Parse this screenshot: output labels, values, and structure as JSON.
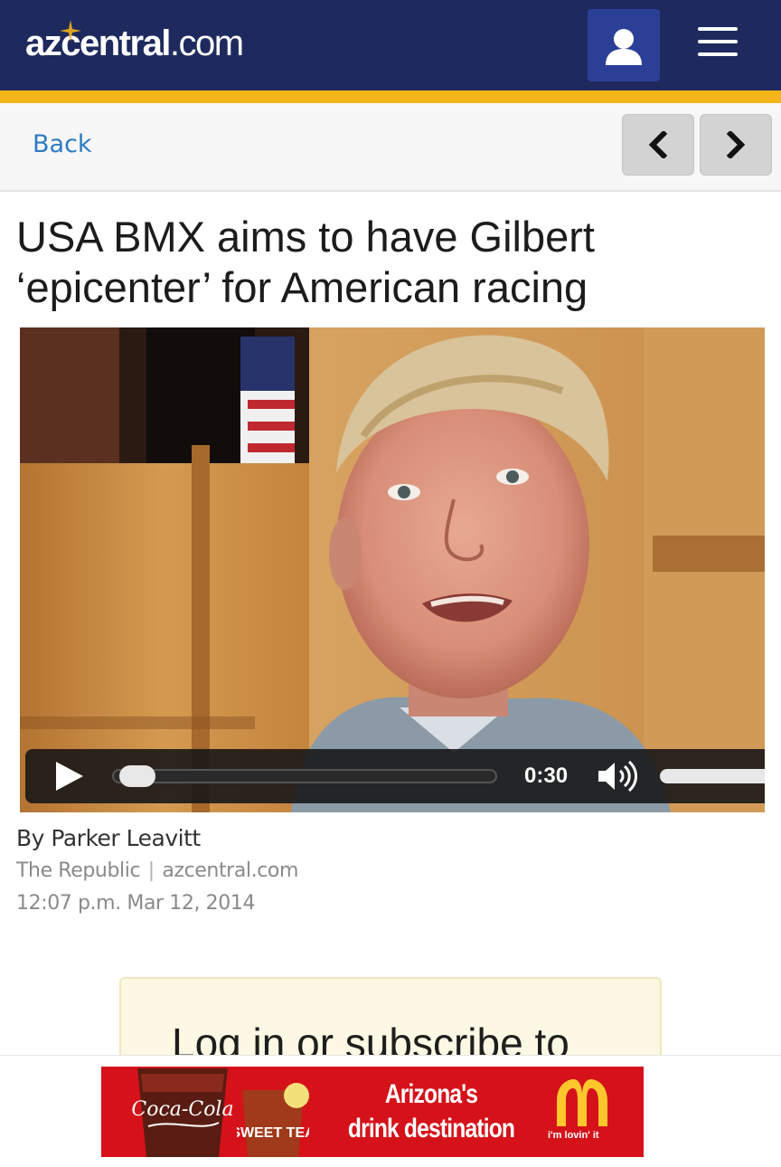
{
  "header": {
    "logo": {
      "az": "az",
      "central": "central",
      "dotcom": ".com"
    },
    "user_icon": "user-silhouette-icon",
    "menu_icon": "hamburger-menu-icon",
    "colors": {
      "bar": "#1e2a5e",
      "stripe": "#f2b418",
      "user_button": "#2c3f96"
    }
  },
  "subnav": {
    "back_label": "Back",
    "prev_icon": "chevron-left-icon",
    "next_icon": "chevron-right-icon",
    "link_color": "#2e7bc4"
  },
  "article": {
    "headline": "USA BMX aims to have Gilbert ‘epicenter’ for American racing",
    "byline": "By Parker Leavitt",
    "source": "The Republic",
    "source_site": "azcentral.com",
    "timestamp": "12:07 p.m. Mar 12, 2014"
  },
  "video": {
    "time": "0:30",
    "play_icon": "play-icon",
    "volume_icon": "volume-icon",
    "progress": 0.02
  },
  "subscribe": {
    "text": "Log in or subscribe to"
  },
  "ad": {
    "headline_line1": "Arizona's",
    "headline_line2": "drink destination",
    "brand_script": "Coca-Cola",
    "tea_label": "SWEET TEA",
    "slogan": "i'm lovin' it",
    "background": "#d5121a"
  }
}
